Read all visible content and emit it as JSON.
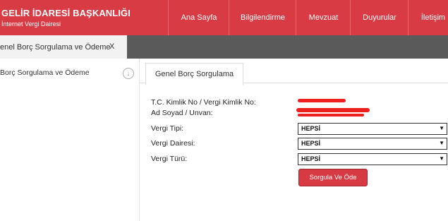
{
  "header": {
    "title": "GELİR İDARESİ BAŞKANLIĞI",
    "subtitle": "İnternet Vergi Dairesi",
    "nav": [
      "Ana Sayfa",
      "Bilgilendirme",
      "Mevzuat",
      "Duyurular",
      "İletişim"
    ],
    "bg_color": "#d93b45"
  },
  "tabbar": {
    "active_tab": "enel Borç Sorgulama ve Ödeme",
    "close_label": "X"
  },
  "sidebar": {
    "item": "Borç Sorgulama ve Ödeme",
    "icon": "chevron-down-circle-icon"
  },
  "main": {
    "tab": "Genel Borç Sorgulama",
    "fields": {
      "tc_label": "T.C. Kimlik No / Vergi Kimlik No:",
      "name_label": "Ad Soyad / Unvan:",
      "tax_type_label": "Vergi Tipi:",
      "tax_office_label": "Vergi Dairesi:",
      "tax_kind_label": "Vergi Türü:"
    },
    "selects": {
      "tax_type": "HEPSİ",
      "tax_office": "HEPSİ",
      "tax_kind": "HEPSİ"
    },
    "button": "Sorgula Ve Öde",
    "button_color": "#d83a44"
  }
}
